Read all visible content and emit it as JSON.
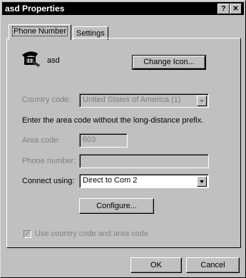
{
  "window": {
    "title": "asd Properties",
    "help": "?",
    "close": "✕"
  },
  "tabs": [
    {
      "label": "Phone Number"
    },
    {
      "label": "Settings"
    }
  ],
  "entry": {
    "name": "asd",
    "change_icon_button": "Change Icon..."
  },
  "country": {
    "label": "Country code:",
    "value": "United States of America (1)"
  },
  "instructions": "Enter the area code without the long-distance prefix.",
  "area": {
    "label": "Area code:",
    "value": "603"
  },
  "phone": {
    "label": "Phone number:",
    "value": ""
  },
  "connect": {
    "label": "Connect using:",
    "value": "Direct to Com 2"
  },
  "configure_button": "Configure...",
  "use_country_code": {
    "label": "Use country code and area code",
    "checked": true
  },
  "footer": {
    "ok": "OK",
    "cancel": "Cancel"
  }
}
